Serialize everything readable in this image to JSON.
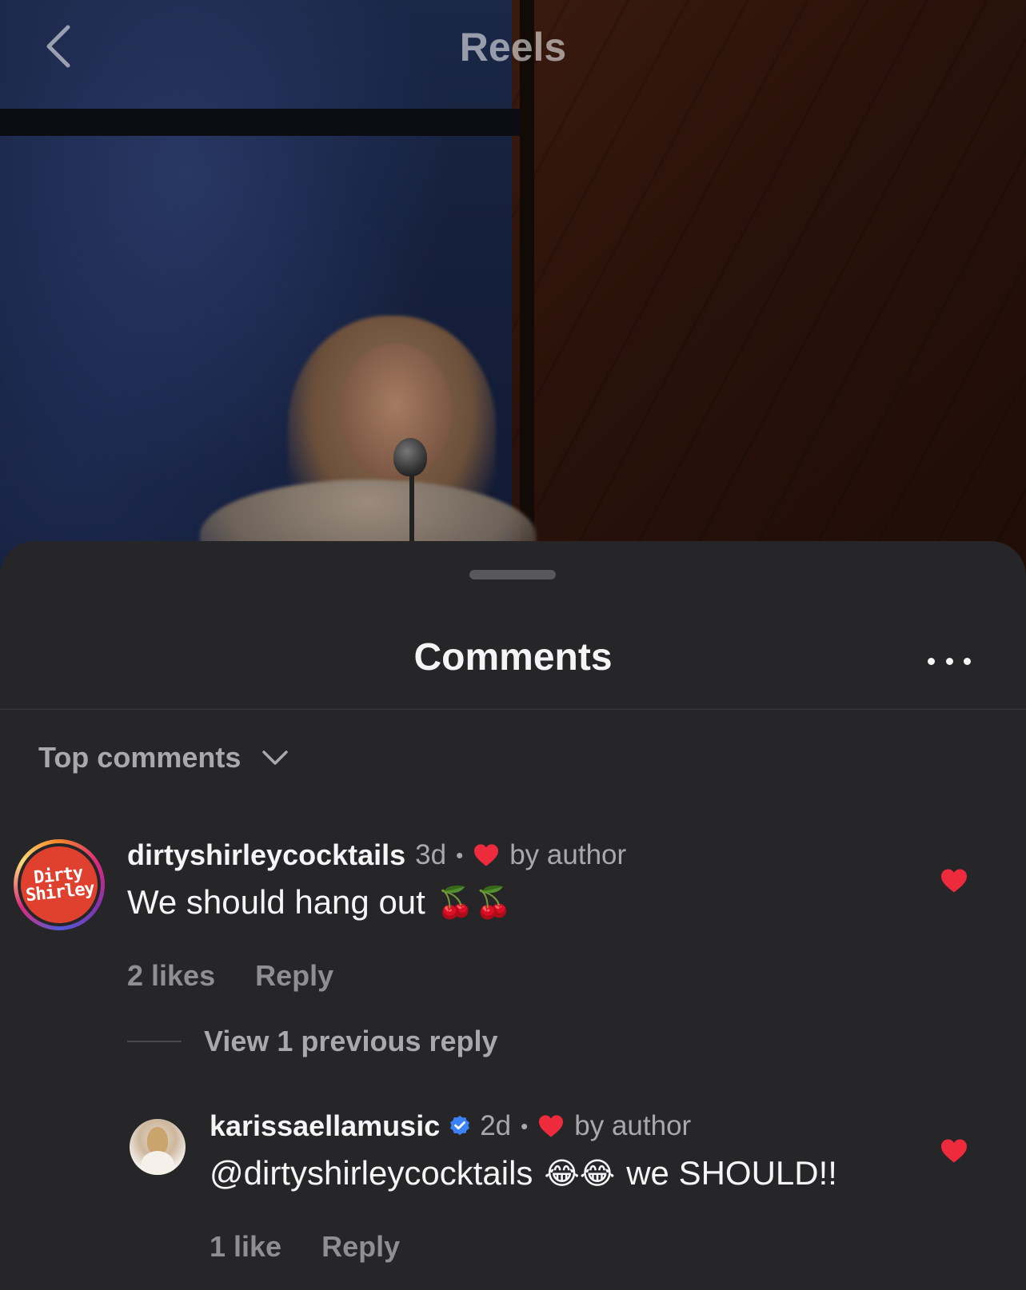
{
  "header": {
    "title": "Reels"
  },
  "sheet": {
    "title": "Comments",
    "sort_label": "Top comments"
  },
  "comments": [
    {
      "username": "dirtyshirleycocktails",
      "avatar_text_line1": "Dirty",
      "avatar_text_line2": "Shirley",
      "time": "3d",
      "liked_by_author_label": "by author",
      "text": "We should hang out",
      "emoji": "🍒🍒",
      "likes_label": "2 likes",
      "reply_label": "Reply",
      "liked": true
    }
  ],
  "thread": {
    "view_previous_label": "View 1 previous reply"
  },
  "replies": [
    {
      "username": "karissaellamusic",
      "verified": true,
      "time": "2d",
      "liked_by_author_label": "by author",
      "text": "@dirtyshirleycocktails",
      "emoji": "😂😂",
      "text_tail": "we SHOULD!!",
      "likes_label": "1 like",
      "reply_label": "Reply",
      "liked": true
    }
  ],
  "colors": {
    "sheet_bg": "#262628",
    "heart_red": "#ee2a3d",
    "verified_blue": "#3b82f6",
    "secondary_text": "#a9a9ad"
  },
  "icons": {
    "back": "chevron-left-icon",
    "more": "more-horizontal-icon",
    "sort": "chevron-down-icon",
    "heart": "heart-icon",
    "verified": "verified-badge-icon"
  }
}
